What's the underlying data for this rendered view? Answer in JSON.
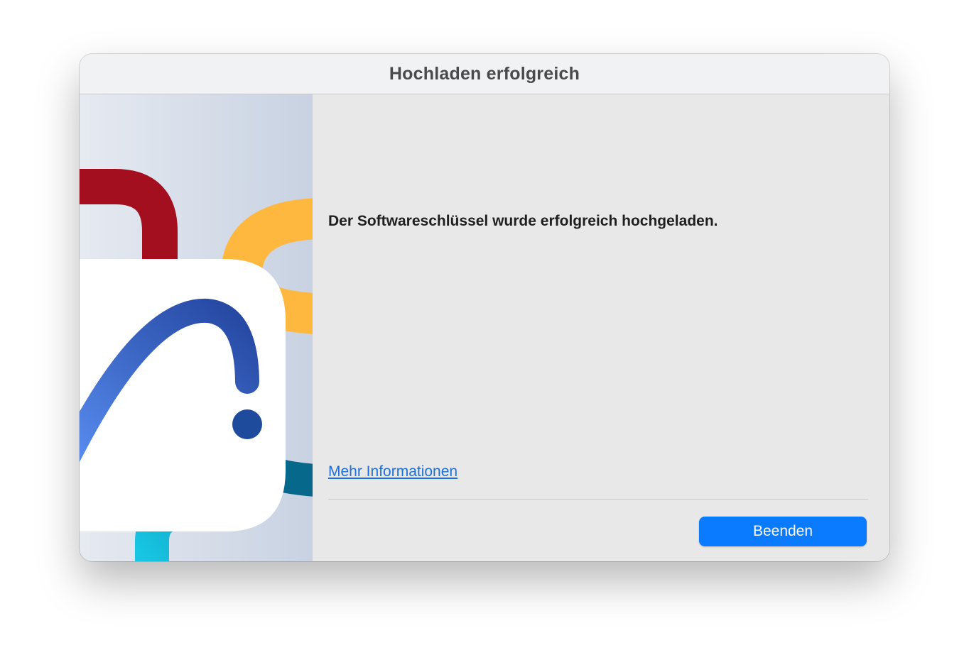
{
  "window": {
    "title": "Hochladen erfolgreich"
  },
  "content": {
    "message": "Der Softwareschlüssel wurde erfolgreich hochgeladen.",
    "more_info_link": "Mehr Informationen",
    "quit_button": "Beenden"
  },
  "colors": {
    "accent": "#0a7aff",
    "link": "#1f6fd6",
    "illustration_red": "#a30f1f",
    "illustration_yellow": "#ffb83f",
    "illustration_blue": "#3f6fd0",
    "illustration_teal": "#06688a",
    "illustration_cyan": "#17c6e3"
  },
  "illustration": {
    "icon": "key-lock-illustration-icon"
  }
}
